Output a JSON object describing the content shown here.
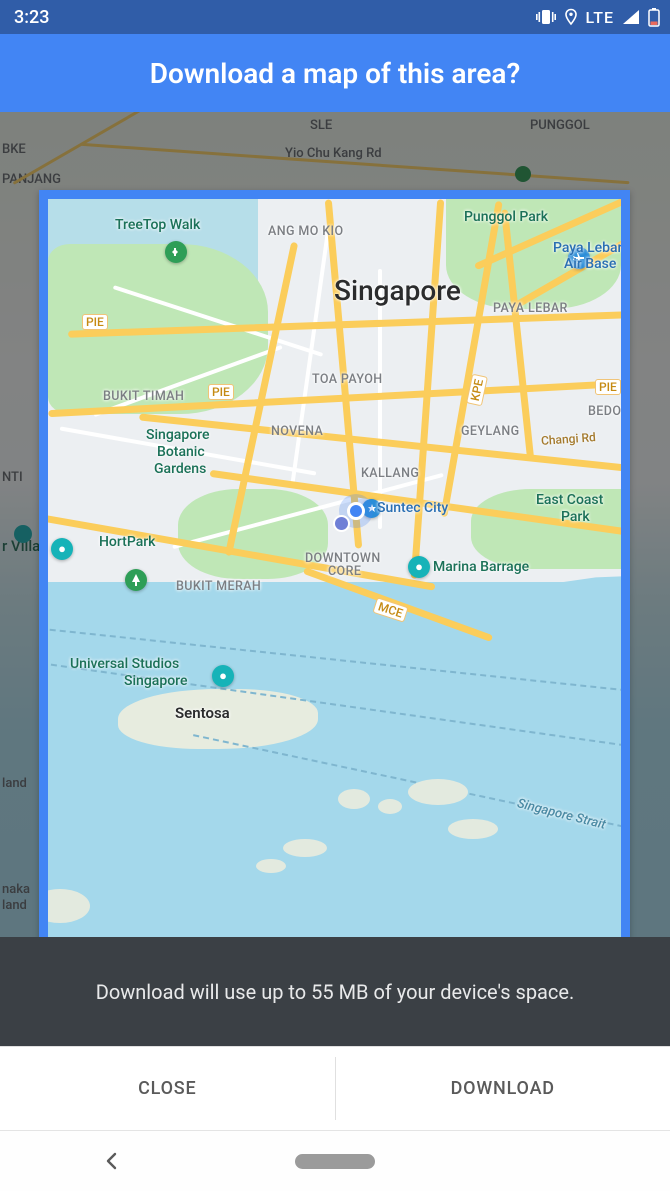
{
  "status_bar": {
    "time": "3:23",
    "network_type": "LTE"
  },
  "header": {
    "title": "Download a map of this area?"
  },
  "map": {
    "main_city": "Singapore",
    "poi": {
      "treetop_walk": "TreeTop Walk",
      "punggol_park": "Punggol Park",
      "paya_lebar_air_base_l1": "Paya Lebar",
      "paya_lebar_air_base_l2": "Air Base",
      "botanic_gardens_l1": "Singapore",
      "botanic_gardens_l2": "Botanic",
      "botanic_gardens_l3": "Gardens",
      "hortpark": "HortPark",
      "suntec_city": "Suntec City",
      "marina_barrage": "Marina Barrage",
      "east_coast_park_l1": "East Coast",
      "east_coast_park_l2": "Park",
      "universal_l1": "Universal Studios",
      "universal_l2": "Singapore"
    },
    "districts": {
      "ang_mo_kio": "ANG MO KIO",
      "paya_lebar": "PAYA LEBAR",
      "toa_payoh": "TOA PAYOH",
      "bukit_timah": "BUKIT TIMAH",
      "novena": "NOVENA",
      "geylang": "GEYLANG",
      "kallang": "KALLANG",
      "bukit_merah": "BUKIT MERAH",
      "downtown_core_l1": "DOWNTOWN",
      "downtown_core_l2": "CORE",
      "bedok": "BEDOK",
      "sentosa": "Sentosa"
    },
    "roads": {
      "pie_w": "PIE",
      "pie_c": "PIE",
      "pie_e": "PIE",
      "kpe": "KPE",
      "mce": "MCE",
      "changi_rd": "Changi Rd"
    },
    "water_label": "Singapore Strait",
    "background_labels": {
      "sle": "SLE",
      "yio_chu_kang": "Yio Chu Kang Rd",
      "bke": "BKE",
      "panjang": "PANJANG",
      "nti": "NTI",
      "villa": "r Villa",
      "land1": "land",
      "naka": "naka",
      "land2": "land",
      "punggol": "PUNGGOL"
    }
  },
  "message": {
    "text": "Download will use up to 55 MB of your device's space."
  },
  "buttons": {
    "close": "CLOSE",
    "download": "DOWNLOAD"
  }
}
